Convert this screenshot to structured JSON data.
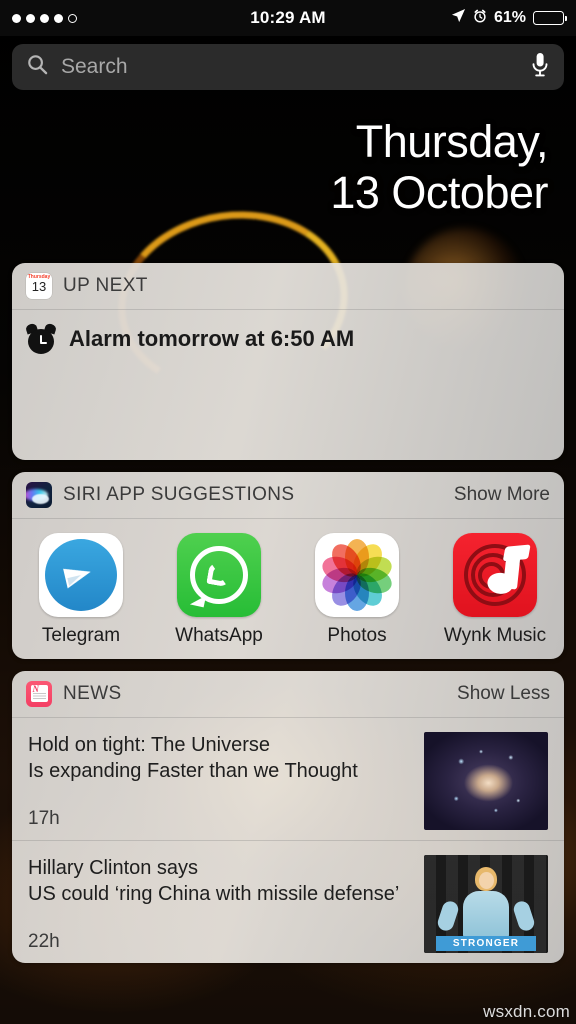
{
  "status_bar": {
    "signal_dots_filled": 4,
    "signal_dots_total": 5,
    "time": "10:29 AM",
    "battery_percent": "61%",
    "battery_level": 61,
    "icons": [
      "location-arrow-icon",
      "alarm-clock-icon",
      "battery-icon"
    ]
  },
  "search": {
    "placeholder": "Search",
    "value": "",
    "search_icon": "search-icon",
    "mic_icon": "microphone-icon"
  },
  "date": {
    "line1": "Thursday,",
    "line2": "13 October"
  },
  "up_next": {
    "title": "UP NEXT",
    "icon": "calendar-icon",
    "calendar_weekday": "Thursday",
    "calendar_day": "13",
    "event_icon": "alarm-clock-icon",
    "event_text": "Alarm tomorrow at 6:50 AM"
  },
  "siri_suggestions": {
    "title": "SIRI APP SUGGESTIONS",
    "icon": "siri-icon",
    "action": "Show More",
    "apps": [
      {
        "label": "Telegram",
        "icon": "telegram-icon"
      },
      {
        "label": "WhatsApp",
        "icon": "whatsapp-icon"
      },
      {
        "label": "Photos",
        "icon": "photos-icon"
      },
      {
        "label": "Wynk Music",
        "icon": "wynk-music-icon"
      }
    ]
  },
  "news": {
    "title": "NEWS",
    "icon": "news-icon",
    "action": "Show Less",
    "items": [
      {
        "headline_line1": "Hold on tight: The Universe",
        "headline_line2": "Is expanding Faster than we Thought",
        "time": "17h",
        "thumbnail": "galaxy-photo"
      },
      {
        "headline_line1": "Hillary Clinton says",
        "headline_line2": "US could ‘ring China with missile defense’",
        "time": "22h",
        "thumbnail": "hillary-clinton-photo",
        "thumbnail_banner": "STRONGER"
      }
    ]
  },
  "watermark": "wsxdn.com",
  "colors": {
    "accent_orange": "#e8a21a",
    "widget_bg": "#e4e1dc",
    "news_red": "#f43f64",
    "telegram_blue": "#2387c8",
    "whatsapp_green": "#27bd36",
    "wynk_red": "#e0121e"
  }
}
